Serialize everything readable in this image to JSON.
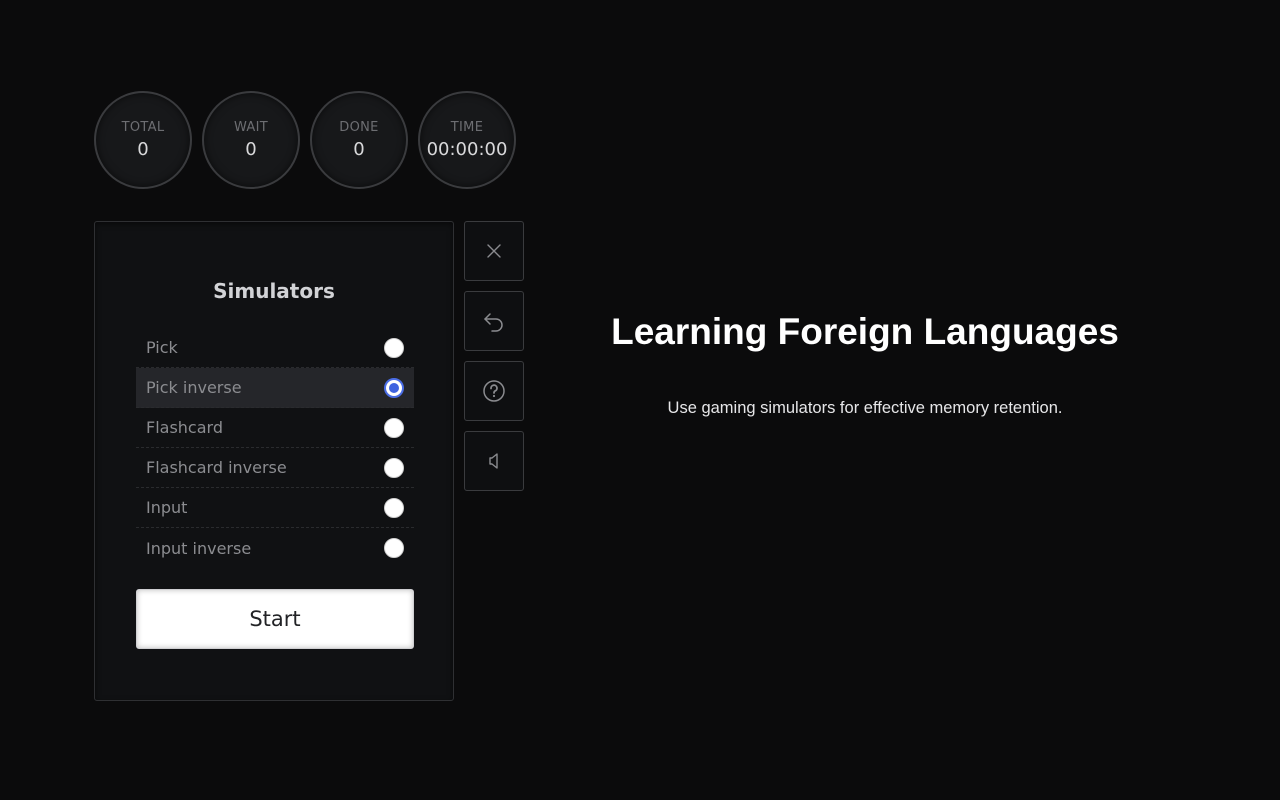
{
  "stats": [
    {
      "label": "TOTAL",
      "value": "0"
    },
    {
      "label": "WAIT",
      "value": "0"
    },
    {
      "label": "DONE",
      "value": "0"
    },
    {
      "label": "TIME",
      "value": "00:00:00"
    }
  ],
  "panel": {
    "title": "Simulators",
    "items": [
      {
        "label": "Pick",
        "selected": false
      },
      {
        "label": "Pick inverse",
        "selected": true
      },
      {
        "label": "Flashcard",
        "selected": false
      },
      {
        "label": "Flashcard inverse",
        "selected": false
      },
      {
        "label": "Input",
        "selected": false
      },
      {
        "label": "Input inverse",
        "selected": false
      }
    ],
    "start_label": "Start"
  },
  "tools": [
    {
      "icon": "close-icon"
    },
    {
      "icon": "undo-icon"
    },
    {
      "icon": "help-icon"
    },
    {
      "icon": "speaker-icon"
    }
  ],
  "hero": {
    "title": "Learning Foreign Languages",
    "subtitle": "Use gaming simulators for effective memory retention."
  },
  "colors": {
    "background": "#0b0b0c",
    "accent": "#3f63e0",
    "selected_row": "#25262a"
  }
}
